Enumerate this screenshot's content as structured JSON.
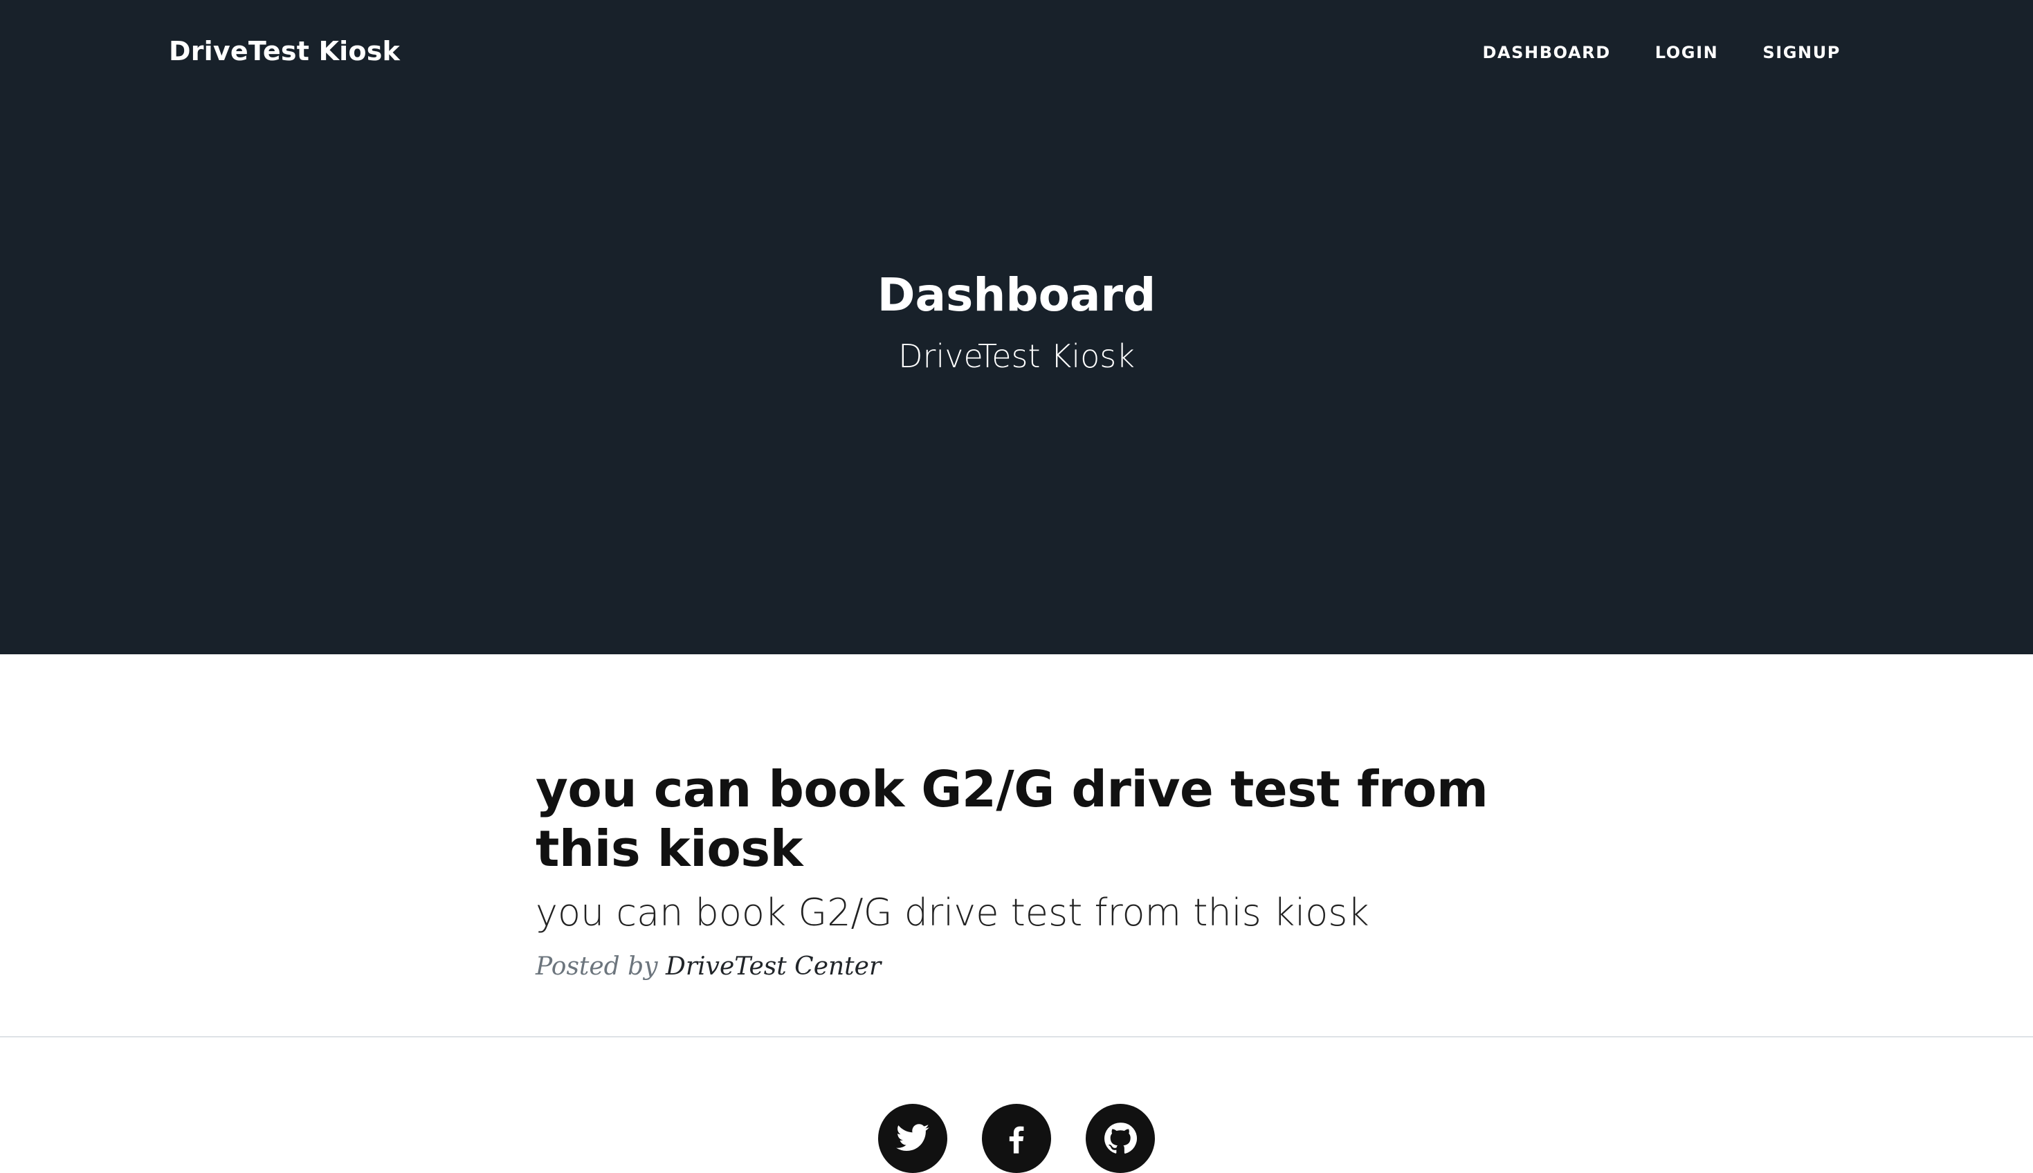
{
  "navbar": {
    "brand": "DriveTest Kiosk",
    "links": [
      "DASHBOARD",
      "LOGIN",
      "SIGNUP"
    ]
  },
  "header": {
    "title": "Dashboard",
    "subtitle": "DriveTest Kiosk"
  },
  "post": {
    "title": "you can book G2/G drive test from this kiosk",
    "subtitle": "you can book G2/G drive test from this kiosk",
    "posted_by_label": "Posted by",
    "author": "DriveTest Center"
  },
  "footer": {
    "social_icons": [
      "twitter-icon",
      "facebook-icon",
      "github-icon"
    ]
  },
  "colors": {
    "masthead_bg": "#18212a",
    "text_dark": "#111111",
    "meta_gray": "#6c757d"
  }
}
